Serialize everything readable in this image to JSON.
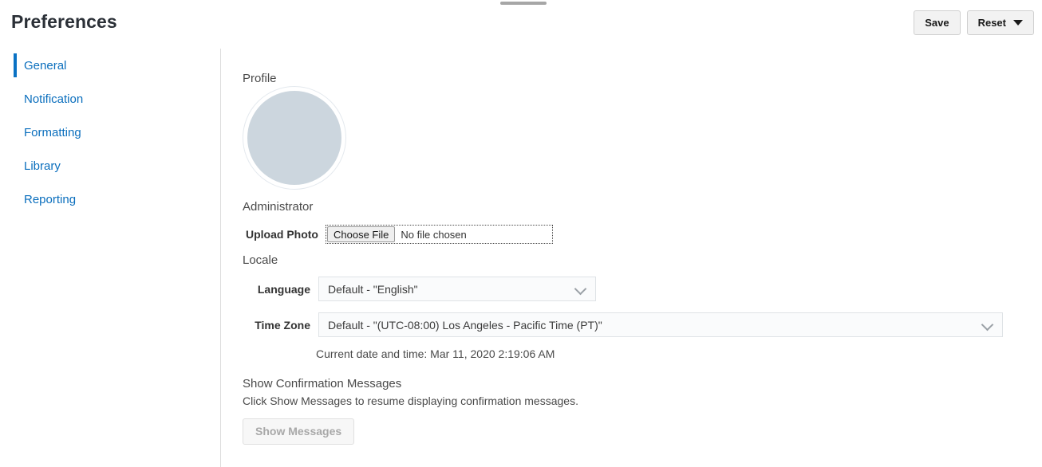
{
  "window": {
    "drag_handle": "drag-handle"
  },
  "header": {
    "title": "Preferences",
    "save_label": "Save",
    "reset_label": "Reset"
  },
  "sidebar": {
    "items": [
      {
        "label": "General",
        "active": true
      },
      {
        "label": "Notification",
        "active": false
      },
      {
        "label": "Formatting",
        "active": false
      },
      {
        "label": "Library",
        "active": false
      },
      {
        "label": "Reporting",
        "active": false
      }
    ]
  },
  "main": {
    "profile": {
      "heading": "Profile",
      "user_name": "Administrator",
      "upload_label": "Upload Photo",
      "choose_file_label": "Choose File",
      "file_status": "No file chosen"
    },
    "locale": {
      "heading": "Locale",
      "language_label": "Language",
      "language_value": "Default - \"English\"",
      "timezone_label": "Time Zone",
      "timezone_value": "Default - \"(UTC-08:00) Los Angeles - Pacific Time (PT)\"",
      "current_datetime": "Current date and time: Mar 11, 2020 2:19:06 AM"
    },
    "confirmation": {
      "heading": "Show Confirmation Messages",
      "description": "Click Show Messages to resume displaying confirmation messages.",
      "button_label": "Show Messages"
    }
  },
  "colors": {
    "accent": "#0a72c4",
    "link": "#0a6ebd",
    "avatar_fill": "#ccd6de",
    "divider": "#dcdcdc"
  }
}
